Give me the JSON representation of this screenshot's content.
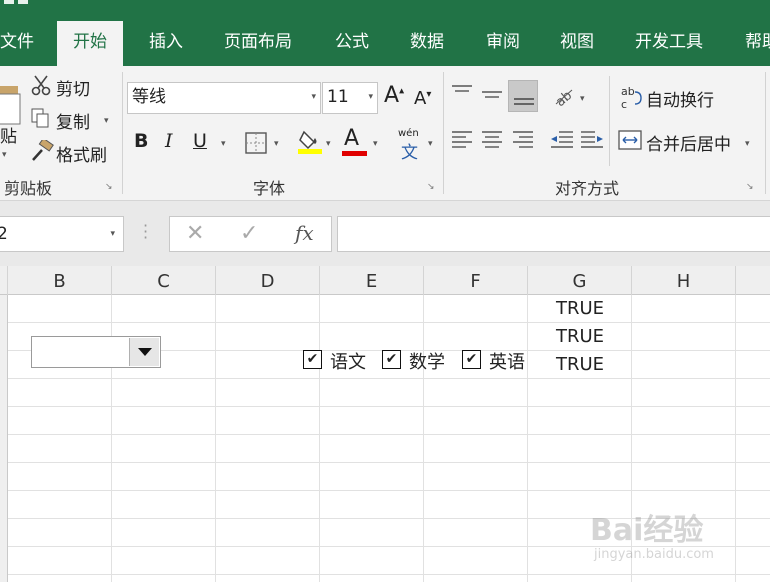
{
  "tabs": [
    {
      "label": "文件",
      "active": false
    },
    {
      "label": "开始",
      "active": true
    },
    {
      "label": "插入",
      "active": false
    },
    {
      "label": "页面布局",
      "active": false
    },
    {
      "label": "公式",
      "active": false
    },
    {
      "label": "数据",
      "active": false
    },
    {
      "label": "审阅",
      "active": false
    },
    {
      "label": "视图",
      "active": false
    },
    {
      "label": "开发工具",
      "active": false
    },
    {
      "label": "帮助",
      "active": false
    }
  ],
  "clipboard": {
    "paste_label": "贴",
    "cut_label": "剪切",
    "copy_label": "复制",
    "format_painter_label": "格式刷",
    "group_label": "剪贴板"
  },
  "font": {
    "name": "等线",
    "size": "11",
    "bold_label": "B",
    "italic_label": "I",
    "underline_label": "U",
    "font_color_label": "A",
    "phonetic_label": "wén",
    "phonetic_char": "文",
    "group_label": "字体",
    "highlight_color": "#ffff00",
    "font_color": "#e00000"
  },
  "alignment": {
    "wrap_text_label": "自动换行",
    "merge_center_label": "合并后居中",
    "group_label": "对齐方式"
  },
  "formula_bar": {
    "name_box": "2",
    "fx_label": "fx"
  },
  "columns": [
    "B",
    "C",
    "D",
    "E",
    "F",
    "G",
    "H"
  ],
  "cells": {
    "g_values": [
      "TRUE",
      "TRUE",
      "TRUE"
    ]
  },
  "checkboxes": [
    {
      "label": "语文",
      "checked": true
    },
    {
      "label": "数学",
      "checked": true
    },
    {
      "label": "英语",
      "checked": true
    }
  ],
  "watermark": {
    "brand": "Bai经验",
    "url": "jingyan.baidu.com"
  },
  "colors": {
    "accent": "#217346",
    "ribbon_bg": "#f3f3f3"
  }
}
